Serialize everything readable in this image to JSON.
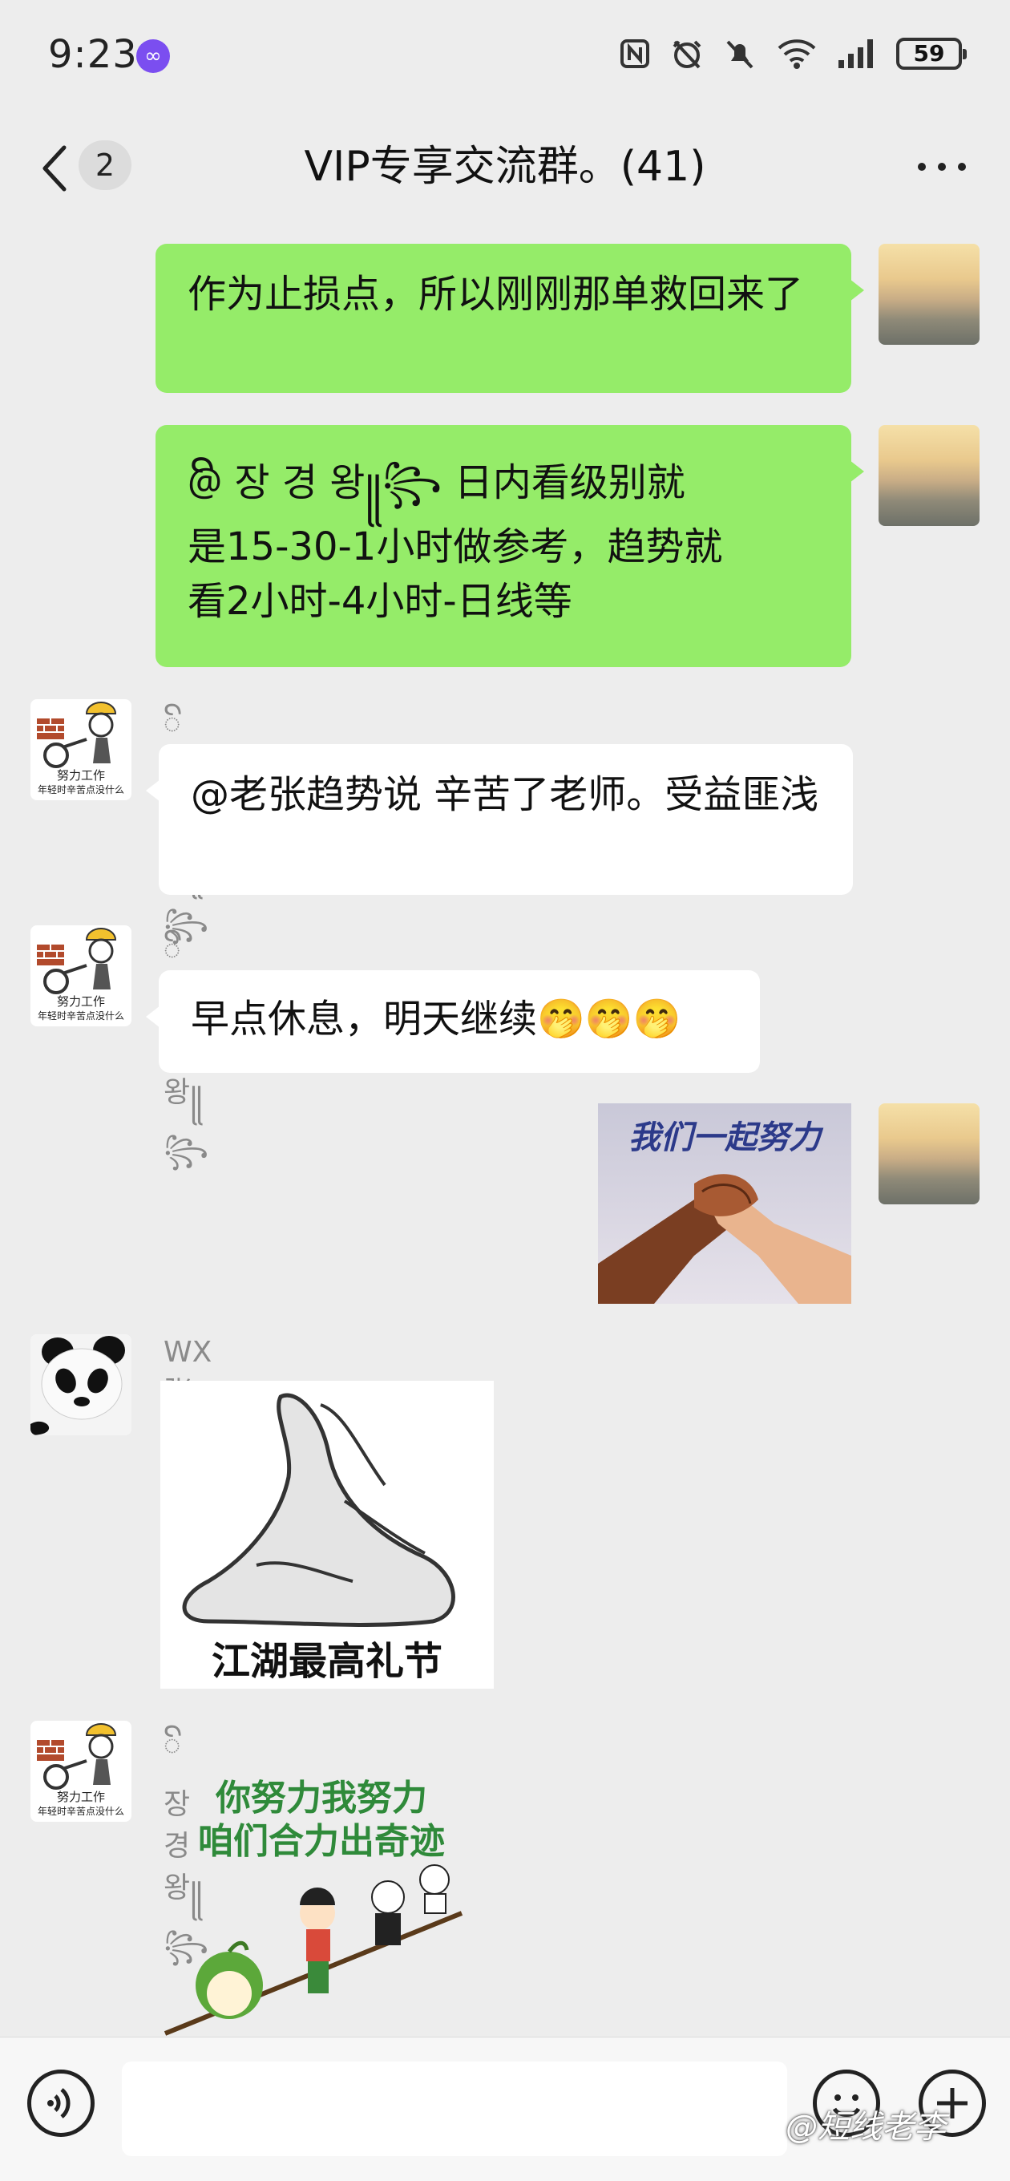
{
  "status_bar": {
    "time": "9:23",
    "battery": "59",
    "icons": [
      "nfc-icon",
      "alarm-off-icon",
      "mute-icon",
      "wifi-icon",
      "signal-icon"
    ]
  },
  "nav": {
    "unread_count": "2",
    "title": "VIP专享交流群。(41)"
  },
  "messages": [
    {
      "side": "right",
      "avatar": "sunset-avatar",
      "text": "作为止损点，所以刚刚那单救回来了"
    },
    {
      "side": "right",
      "avatar": "sunset-avatar",
      "text_line1": "@ꦼ 장 경 왕꧋꧂ 日内看级别就",
      "text_line2": "是15-30-1小时做参考，趋势就",
      "text_line3": "看2小时-4小时-日线等"
    },
    {
      "side": "left",
      "sender": "ꦼ 장 경 왕꧋꧂",
      "avatar": "worker-cartoon-avatar",
      "avatar_caption1": "努力工作",
      "avatar_caption2": "年轻时辛苦点没什么",
      "text": "@老张趋势说  辛苦了老师。受益匪浅"
    },
    {
      "side": "left",
      "sender": "ꦼ 장 경 왕꧋꧂",
      "avatar": "worker-cartoon-avatar",
      "avatar_caption1": "努力工作",
      "avatar_caption2": "年轻时辛苦点没什么",
      "text": "早点休息，明天继续",
      "emojis": "🤭🤭🤭"
    },
    {
      "side": "right",
      "avatar": "sunset-avatar",
      "image": "handshake-sticker",
      "image_caption": "我们一起努力"
    },
    {
      "side": "left",
      "sender": "WX 张雄🤓",
      "avatar": "panda-avatar",
      "image": "clasped-hands-sticker",
      "image_caption": "江湖最高礼节"
    },
    {
      "side": "left",
      "sender": "ꦼ 장 경 왕꧋꧂",
      "avatar": "worker-cartoon-avatar",
      "avatar_caption1": "努力工作",
      "avatar_caption2": "年轻时辛苦点没什么",
      "image": "cartoon-team-sticker",
      "image_caption_line1": "你努力我努力",
      "image_caption_line2": "咱们合力出奇迹"
    }
  ],
  "input_bar": {
    "placeholder": "",
    "watermark": "@短线老李"
  },
  "colors": {
    "background": "#ededed",
    "bubble_self": "#95ec69",
    "bubble_other": "#ffffff",
    "accent": "#7b4ef0"
  }
}
